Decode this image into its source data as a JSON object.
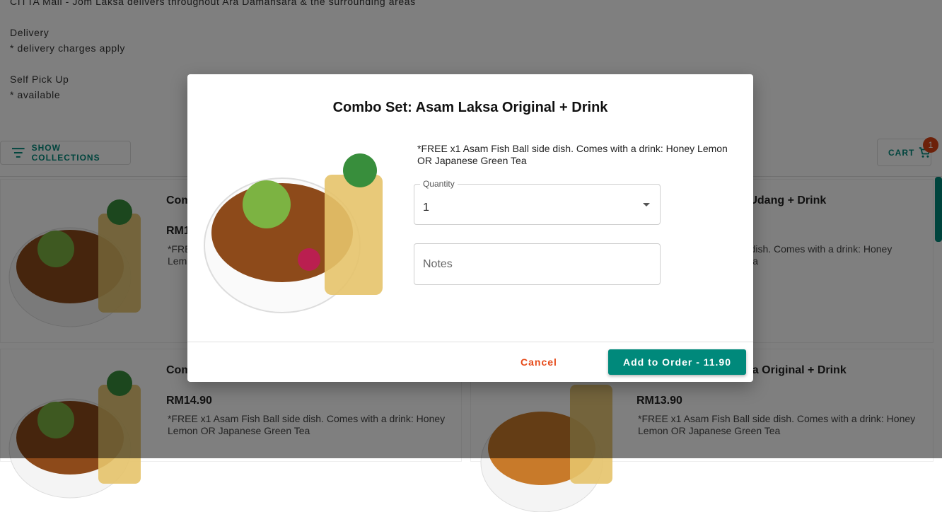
{
  "store": {
    "tagline": "CITTA Mall - Jom Laksa delivers throughout Ara Damansara & the surrounding areas",
    "delivery_label": "Delivery",
    "delivery_note": "* delivery charges apply",
    "pickup_label": "Self Pick Up",
    "pickup_note": "* available"
  },
  "toolbar": {
    "collections_label": "SHOW COLLECTIONS",
    "cart_label": "CART",
    "cart_count": "1"
  },
  "menu": {
    "items": [
      {
        "name": "Com",
        "price": "RM1",
        "desc": "*FRE\nLem"
      },
      {
        "name": "a Udang + Drink",
        "price": "",
        "desc": "ide dish. Comes with a drink: Honey\nn Tea"
      },
      {
        "name": "Com",
        "price": "RM14.90",
        "desc": "*FREE x1 Asam Fish Ball side dish. Comes with a drink: Honey Lemon OR Japanese Green Tea"
      },
      {
        "name": "ksa Original + Drink",
        "price": "RM13.90",
        "desc": "*FREE x1 Asam Fish Ball side dish. Comes with a drink: Honey Lemon OR Japanese Green Tea"
      }
    ]
  },
  "modal": {
    "title": "Combo Set: Asam Laksa Original + Drink",
    "description": "*FREE x1 Asam Fish Ball side dish. Comes with a drink: Honey Lemon OR Japanese Green Tea",
    "quantity_label": "Quantity",
    "quantity_value": "1",
    "notes_placeholder": "Notes",
    "cancel_label": "Cancel",
    "add_label": "Add to Order - 11.90"
  },
  "colors": {
    "accent": "#00897b",
    "cancel": "#e64a19",
    "badge": "#d84315"
  }
}
